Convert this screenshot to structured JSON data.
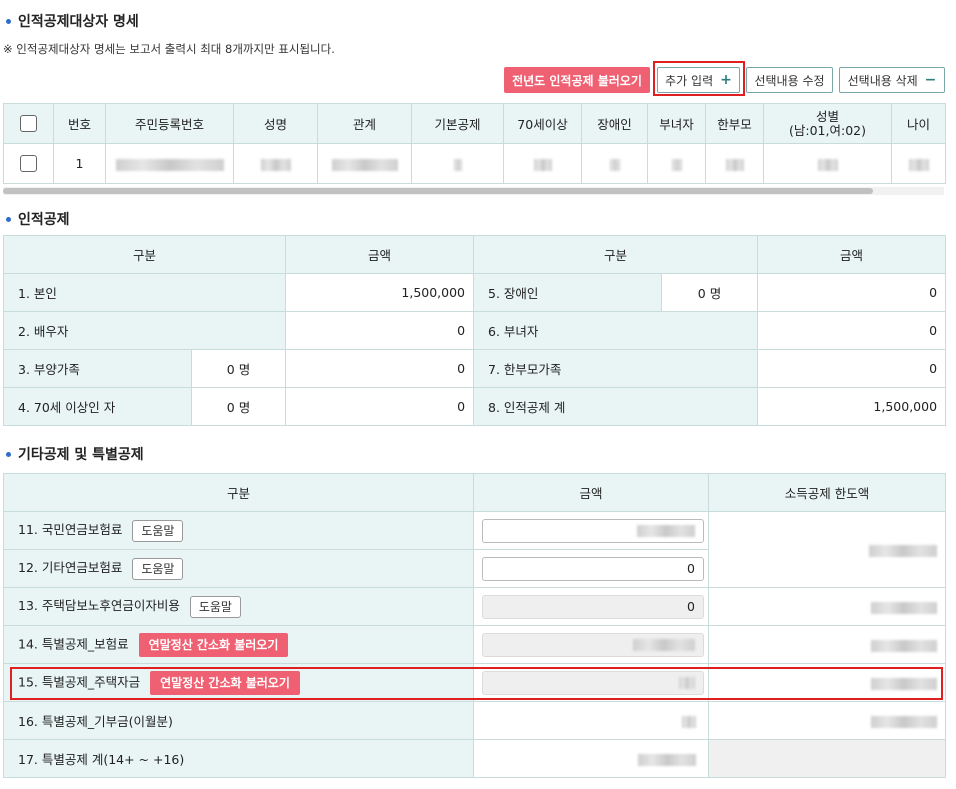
{
  "sec1": {
    "title": "인적공제대상자 명세",
    "note": "※ 인적공제대상자 명세는 보고서 출력시 최대 8개까지만 표시됩니다.",
    "buttons": {
      "load_prev": "전년도 인적공제 불러오기",
      "add": "추가 입력",
      "add_icon": "+",
      "edit": "선택내용 수정",
      "delete": "선택내용 삭제",
      "delete_icon": "−"
    },
    "headers": [
      "번호",
      "주민등록번호",
      "성명",
      "관계",
      "기본공제",
      "70세이상",
      "장애인",
      "부녀자",
      "한부모",
      "성별",
      "(남:01,여:02)",
      "나이"
    ],
    "row": {
      "no": "1"
    }
  },
  "sec2": {
    "title": "인적공제",
    "headers": {
      "col1": "구분",
      "col2": "금액",
      "col3": "구분",
      "col4": "금액"
    },
    "unit": "명",
    "rows": [
      {
        "label": "1. 본인",
        "amount": "1,500,000",
        "label2": "5. 장애인",
        "count2": "0",
        "amount2": "0"
      },
      {
        "label": "2. 배우자",
        "amount": "0",
        "label2": "6. 부녀자",
        "amount2": "0"
      },
      {
        "label": "3. 부양가족",
        "count": "0",
        "amount": "0",
        "label2": "7. 한부모가족",
        "amount2": "0"
      },
      {
        "label": "4. 70세 이상인 자",
        "count": "0",
        "amount": "0",
        "label2": "8. 인적공제 계",
        "amount2": "1,500,000"
      }
    ]
  },
  "sec3": {
    "title": "기타공제 및 특별공제",
    "headers": {
      "col1": "구분",
      "col2": "금액",
      "col3": "소득공제 한도액"
    },
    "help": "도움말",
    "load_simple": "연말정산 간소화 불러오기",
    "rows": [
      {
        "label": "11. 국민연금보험료"
      },
      {
        "label": "12. 기타연금보험료",
        "value": "0"
      },
      {
        "label": "13. 주택담보노후연금이자비용",
        "value": "0"
      },
      {
        "label": "14. 특별공제_보험료"
      },
      {
        "label": "15. 특별공제_주택자금"
      },
      {
        "label": "16. 특별공제_기부금(이월분)"
      },
      {
        "label": "17. 특별공제 계(14+ ~ +16)"
      }
    ]
  }
}
